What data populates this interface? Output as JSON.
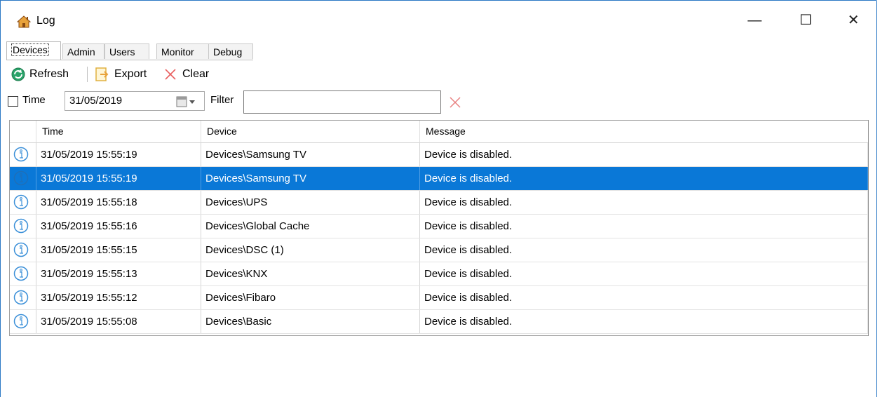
{
  "window": {
    "title": "Log",
    "icon": "house-icon",
    "controls": {
      "minimize": "—",
      "maximize": "☐",
      "close": "✕"
    }
  },
  "tabs": [
    {
      "label": "Devices",
      "active": true
    },
    {
      "label": "Admin"
    },
    {
      "label": "Users"
    },
    {
      "label": "Monitor"
    },
    {
      "label": "Debug"
    }
  ],
  "toolbar": {
    "refresh_label": "Refresh",
    "export_label": "Export",
    "clear_label": "Clear"
  },
  "filter": {
    "time_checked": false,
    "time_label": "Time",
    "date_value": "31/05/2019",
    "filter_label": "Filter",
    "filter_value": ""
  },
  "grid": {
    "columns": [
      "Time",
      "Device",
      "Message"
    ],
    "rows": [
      {
        "time": "31/05/2019 15:55:19",
        "device": "Devices\\Samsung TV",
        "message": "Device is disabled.",
        "selected": false
      },
      {
        "time": "31/05/2019 15:55:19",
        "device": "Devices\\Samsung TV",
        "message": "Device is disabled.",
        "selected": true
      },
      {
        "time": "31/05/2019 15:55:18",
        "device": "Devices\\UPS",
        "message": "Device is disabled.",
        "selected": false
      },
      {
        "time": "31/05/2019 15:55:16",
        "device": "Devices\\Global Cache",
        "message": "Device is disabled.",
        "selected": false
      },
      {
        "time": "31/05/2019 15:55:15",
        "device": "Devices\\DSC (1)",
        "message": "Device is disabled.",
        "selected": false
      },
      {
        "time": "31/05/2019 15:55:13",
        "device": "Devices\\KNX",
        "message": "Device is disabled.",
        "selected": false
      },
      {
        "time": "31/05/2019 15:55:12",
        "device": "Devices\\Fibaro",
        "message": "Device is disabled.",
        "selected": false
      },
      {
        "time": "31/05/2019 15:55:08",
        "device": "Devices\\Basic",
        "message": "Device is disabled.",
        "selected": false
      }
    ]
  },
  "colors": {
    "selection": "#0a78d7",
    "info_icon": "#3a8fd8",
    "clear_x": "#e86060",
    "window_border": "#2b78c5"
  }
}
